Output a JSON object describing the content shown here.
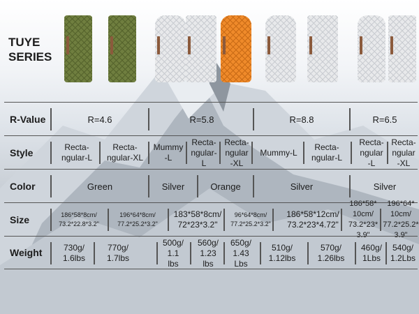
{
  "header": {
    "series_title_line1": "TUYE",
    "series_title_line2": "SERIES"
  },
  "pads": [
    {
      "color": "green"
    },
    {
      "color": "green"
    },
    {
      "color": "silver",
      "shape": "mummy"
    },
    {
      "color": "silver"
    },
    {
      "color": "orange",
      "shape": "mummy"
    },
    {
      "color": "silver",
      "shape": "mummy"
    },
    {
      "color": "silver"
    },
    {
      "color": "silver",
      "shape": "mummy"
    },
    {
      "color": "silver"
    }
  ],
  "rows": {
    "rvalue": {
      "label": "R-Value",
      "cells": [
        "R=4.6",
        "R=5.8",
        "R=8.8",
        "R=6.5"
      ]
    },
    "style": {
      "label": "Style",
      "cells": [
        [
          "Recta-",
          "ngular-L"
        ],
        [
          "Recta-",
          "ngular-XL"
        ],
        [
          "Mummy",
          "-L"
        ],
        [
          "Recta-",
          "ngular-L"
        ],
        [
          "Recta-",
          "ngular",
          "-XL"
        ],
        [
          "Mummy-L"
        ],
        [
          "Recta-",
          "ngular-L"
        ],
        [
          "Recta-",
          "ngular",
          "-L"
        ],
        [
          "Recta-",
          "ngular",
          "-XL"
        ]
      ]
    },
    "color": {
      "label": "Color",
      "cells": [
        "Green",
        "Silver",
        "Orange",
        "Silver",
        "Silver"
      ]
    },
    "size": {
      "label": "Size",
      "cells": [
        [
          "186*58*8cm/",
          "73.2*22.8*3.2\""
        ],
        [
          "196*64*8cm/",
          "77.2*25.2*3.2\""
        ],
        [
          "183*58*8cm/",
          "72*23*3.2\""
        ],
        [
          "96*64*8cm/",
          "77.2*25.2*3.2\""
        ],
        [
          "186*58*12cm/",
          "73.2*23*4.72\""
        ],
        [
          "186*58*",
          "10cm/",
          "73.2*23*",
          "3.9\""
        ],
        [
          "196*64*",
          "10cm/",
          "77.2*25.2*",
          "3.9\""
        ]
      ]
    },
    "weight": {
      "label": "Weight",
      "cells": [
        [
          "730g/",
          "1.6lbs"
        ],
        [
          "770g/",
          "1.7lbs"
        ],
        [
          "500g/",
          "1.1",
          "lbs"
        ],
        [
          "560g/",
          "1.23",
          "lbs"
        ],
        [
          "650g/",
          "1.43",
          "Lbs"
        ],
        [
          "510g/",
          "1.12lbs"
        ],
        [
          "570g/",
          "1.26lbs"
        ],
        [
          "460g/",
          "1Lbs"
        ],
        [
          "540g/",
          "1.2Lbs"
        ]
      ]
    }
  }
}
